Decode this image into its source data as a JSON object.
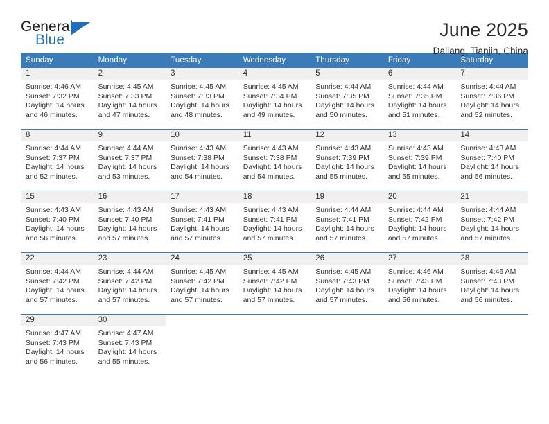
{
  "brand": {
    "name_part1": "General",
    "name_part2": "Blue",
    "triangle_icon": "triangle-icon",
    "accent_color": "#1f6fba"
  },
  "header": {
    "title": "June 2025",
    "location": "Daliang, Tianjin, China"
  },
  "theme": {
    "header_bg": "#3b7cb8",
    "daynum_band_bg": "#f0f0f0",
    "text_color": "#333333"
  },
  "weekdays": [
    "Sunday",
    "Monday",
    "Tuesday",
    "Wednesday",
    "Thursday",
    "Friday",
    "Saturday"
  ],
  "weeks": [
    [
      {
        "day": "1",
        "sunrise": "Sunrise: 4:46 AM",
        "sunset": "Sunset: 7:32 PM",
        "daylight1": "Daylight: 14 hours",
        "daylight2": "and 46 minutes."
      },
      {
        "day": "2",
        "sunrise": "Sunrise: 4:45 AM",
        "sunset": "Sunset: 7:33 PM",
        "daylight1": "Daylight: 14 hours",
        "daylight2": "and 47 minutes."
      },
      {
        "day": "3",
        "sunrise": "Sunrise: 4:45 AM",
        "sunset": "Sunset: 7:33 PM",
        "daylight1": "Daylight: 14 hours",
        "daylight2": "and 48 minutes."
      },
      {
        "day": "4",
        "sunrise": "Sunrise: 4:45 AM",
        "sunset": "Sunset: 7:34 PM",
        "daylight1": "Daylight: 14 hours",
        "daylight2": "and 49 minutes."
      },
      {
        "day": "5",
        "sunrise": "Sunrise: 4:44 AM",
        "sunset": "Sunset: 7:35 PM",
        "daylight1": "Daylight: 14 hours",
        "daylight2": "and 50 minutes."
      },
      {
        "day": "6",
        "sunrise": "Sunrise: 4:44 AM",
        "sunset": "Sunset: 7:35 PM",
        "daylight1": "Daylight: 14 hours",
        "daylight2": "and 51 minutes."
      },
      {
        "day": "7",
        "sunrise": "Sunrise: 4:44 AM",
        "sunset": "Sunset: 7:36 PM",
        "daylight1": "Daylight: 14 hours",
        "daylight2": "and 52 minutes."
      }
    ],
    [
      {
        "day": "8",
        "sunrise": "Sunrise: 4:44 AM",
        "sunset": "Sunset: 7:37 PM",
        "daylight1": "Daylight: 14 hours",
        "daylight2": "and 52 minutes."
      },
      {
        "day": "9",
        "sunrise": "Sunrise: 4:44 AM",
        "sunset": "Sunset: 7:37 PM",
        "daylight1": "Daylight: 14 hours",
        "daylight2": "and 53 minutes."
      },
      {
        "day": "10",
        "sunrise": "Sunrise: 4:43 AM",
        "sunset": "Sunset: 7:38 PM",
        "daylight1": "Daylight: 14 hours",
        "daylight2": "and 54 minutes."
      },
      {
        "day": "11",
        "sunrise": "Sunrise: 4:43 AM",
        "sunset": "Sunset: 7:38 PM",
        "daylight1": "Daylight: 14 hours",
        "daylight2": "and 54 minutes."
      },
      {
        "day": "12",
        "sunrise": "Sunrise: 4:43 AM",
        "sunset": "Sunset: 7:39 PM",
        "daylight1": "Daylight: 14 hours",
        "daylight2": "and 55 minutes."
      },
      {
        "day": "13",
        "sunrise": "Sunrise: 4:43 AM",
        "sunset": "Sunset: 7:39 PM",
        "daylight1": "Daylight: 14 hours",
        "daylight2": "and 55 minutes."
      },
      {
        "day": "14",
        "sunrise": "Sunrise: 4:43 AM",
        "sunset": "Sunset: 7:40 PM",
        "daylight1": "Daylight: 14 hours",
        "daylight2": "and 56 minutes."
      }
    ],
    [
      {
        "day": "15",
        "sunrise": "Sunrise: 4:43 AM",
        "sunset": "Sunset: 7:40 PM",
        "daylight1": "Daylight: 14 hours",
        "daylight2": "and 56 minutes."
      },
      {
        "day": "16",
        "sunrise": "Sunrise: 4:43 AM",
        "sunset": "Sunset: 7:40 PM",
        "daylight1": "Daylight: 14 hours",
        "daylight2": "and 57 minutes."
      },
      {
        "day": "17",
        "sunrise": "Sunrise: 4:43 AM",
        "sunset": "Sunset: 7:41 PM",
        "daylight1": "Daylight: 14 hours",
        "daylight2": "and 57 minutes."
      },
      {
        "day": "18",
        "sunrise": "Sunrise: 4:43 AM",
        "sunset": "Sunset: 7:41 PM",
        "daylight1": "Daylight: 14 hours",
        "daylight2": "and 57 minutes."
      },
      {
        "day": "19",
        "sunrise": "Sunrise: 4:44 AM",
        "sunset": "Sunset: 7:41 PM",
        "daylight1": "Daylight: 14 hours",
        "daylight2": "and 57 minutes."
      },
      {
        "day": "20",
        "sunrise": "Sunrise: 4:44 AM",
        "sunset": "Sunset: 7:42 PM",
        "daylight1": "Daylight: 14 hours",
        "daylight2": "and 57 minutes."
      },
      {
        "day": "21",
        "sunrise": "Sunrise: 4:44 AM",
        "sunset": "Sunset: 7:42 PM",
        "daylight1": "Daylight: 14 hours",
        "daylight2": "and 57 minutes."
      }
    ],
    [
      {
        "day": "22",
        "sunrise": "Sunrise: 4:44 AM",
        "sunset": "Sunset: 7:42 PM",
        "daylight1": "Daylight: 14 hours",
        "daylight2": "and 57 minutes."
      },
      {
        "day": "23",
        "sunrise": "Sunrise: 4:44 AM",
        "sunset": "Sunset: 7:42 PM",
        "daylight1": "Daylight: 14 hours",
        "daylight2": "and 57 minutes."
      },
      {
        "day": "24",
        "sunrise": "Sunrise: 4:45 AM",
        "sunset": "Sunset: 7:42 PM",
        "daylight1": "Daylight: 14 hours",
        "daylight2": "and 57 minutes."
      },
      {
        "day": "25",
        "sunrise": "Sunrise: 4:45 AM",
        "sunset": "Sunset: 7:42 PM",
        "daylight1": "Daylight: 14 hours",
        "daylight2": "and 57 minutes."
      },
      {
        "day": "26",
        "sunrise": "Sunrise: 4:45 AM",
        "sunset": "Sunset: 7:43 PM",
        "daylight1": "Daylight: 14 hours",
        "daylight2": "and 57 minutes."
      },
      {
        "day": "27",
        "sunrise": "Sunrise: 4:46 AM",
        "sunset": "Sunset: 7:43 PM",
        "daylight1": "Daylight: 14 hours",
        "daylight2": "and 56 minutes."
      },
      {
        "day": "28",
        "sunrise": "Sunrise: 4:46 AM",
        "sunset": "Sunset: 7:43 PM",
        "daylight1": "Daylight: 14 hours",
        "daylight2": "and 56 minutes."
      }
    ],
    [
      {
        "day": "29",
        "sunrise": "Sunrise: 4:47 AM",
        "sunset": "Sunset: 7:43 PM",
        "daylight1": "Daylight: 14 hours",
        "daylight2": "and 56 minutes."
      },
      {
        "day": "30",
        "sunrise": "Sunrise: 4:47 AM",
        "sunset": "Sunset: 7:43 PM",
        "daylight1": "Daylight: 14 hours",
        "daylight2": "and 55 minutes."
      },
      null,
      null,
      null,
      null,
      null
    ]
  ]
}
